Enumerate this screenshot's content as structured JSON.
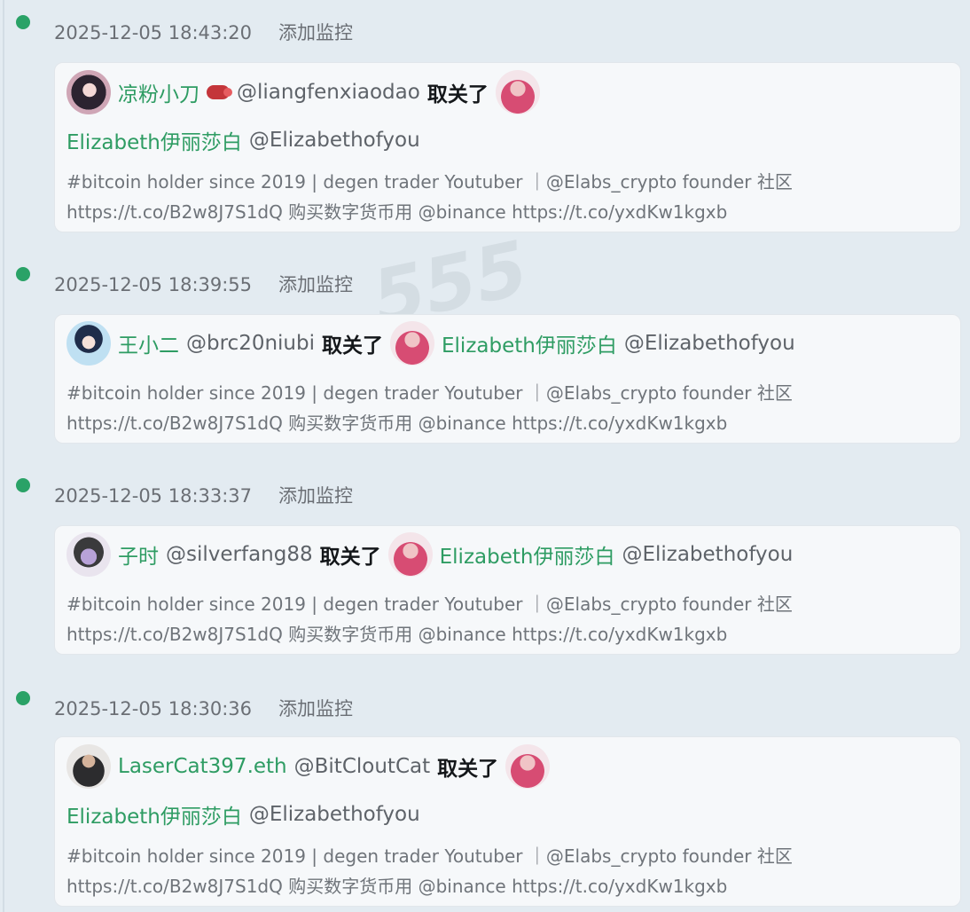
{
  "add_monitor_label": "添加监控",
  "action_unfollow": "取关了",
  "entries": [
    {
      "timestamp": "2025-12-05 18:43:20",
      "actor": {
        "name": "凉粉小刀",
        "handle": "@liangfenxiaodao",
        "avatar_icon": "anime-girl-avatar",
        "badge": "boxing-glove-icon"
      },
      "target": {
        "name": "Elizabeth伊丽莎白",
        "handle": "@Elizabethofyou",
        "avatar_icon": "pink-hair-avatar"
      },
      "bio_line1": "#bitcoin holder since 2019 | degen trader Youtuber ｜@Elabs_crypto founder 社区",
      "bio_line2": "https://t.co/B2w8J7S1dQ 购买数字货币用 @binance https://t.co/yxdKw1kgxb"
    },
    {
      "timestamp": "2025-12-05 18:39:55",
      "actor": {
        "name": "王小二",
        "handle": "@brc20niubi",
        "avatar_icon": "anime-boy-avatar"
      },
      "target": {
        "name": "Elizabeth伊丽莎白",
        "handle": "@Elizabethofyou",
        "avatar_icon": "pink-hair-avatar"
      },
      "bio_line1": "#bitcoin holder since 2019 | degen trader Youtuber ｜@Elabs_crypto founder 社区",
      "bio_line2": "https://t.co/B2w8J7S1dQ 购买数字货币用 @binance https://t.co/yxdKw1kgxb"
    },
    {
      "timestamp": "2025-12-05 18:33:37",
      "actor": {
        "name": "子时",
        "handle": "@silverfang88",
        "avatar_icon": "anime-avatar"
      },
      "target": {
        "name": "Elizabeth伊丽莎白",
        "handle": "@Elizabethofyou",
        "avatar_icon": "pink-hair-avatar"
      },
      "bio_line1": "#bitcoin holder since 2019 | degen trader Youtuber ｜@Elabs_crypto founder 社区",
      "bio_line2": "https://t.co/B2w8J7S1dQ 购买数字货币用 @binance https://t.co/yxdKw1kgxb"
    },
    {
      "timestamp": "2025-12-05 18:30:36",
      "actor": {
        "name": "LaserCat397.eth",
        "handle": "@BitCloutCat",
        "avatar_icon": "man-avatar"
      },
      "target": {
        "name": "Elizabeth伊丽莎白",
        "handle": "@Elizabethofyou",
        "avatar_icon": "pink-hair-avatar"
      },
      "bio_line1": "#bitcoin holder since 2019 | degen trader Youtuber ｜@Elabs_crypto founder 社区",
      "bio_line2": "https://t.co/B2w8J7S1dQ 购买数字货币用 @binance https://t.co/yxdKw1kgxb"
    }
  ],
  "colors": {
    "accent_green": "#2e9c63",
    "status_dot": "#2aa267",
    "background": "#e3ebf1",
    "card": "#f6f8fa"
  }
}
